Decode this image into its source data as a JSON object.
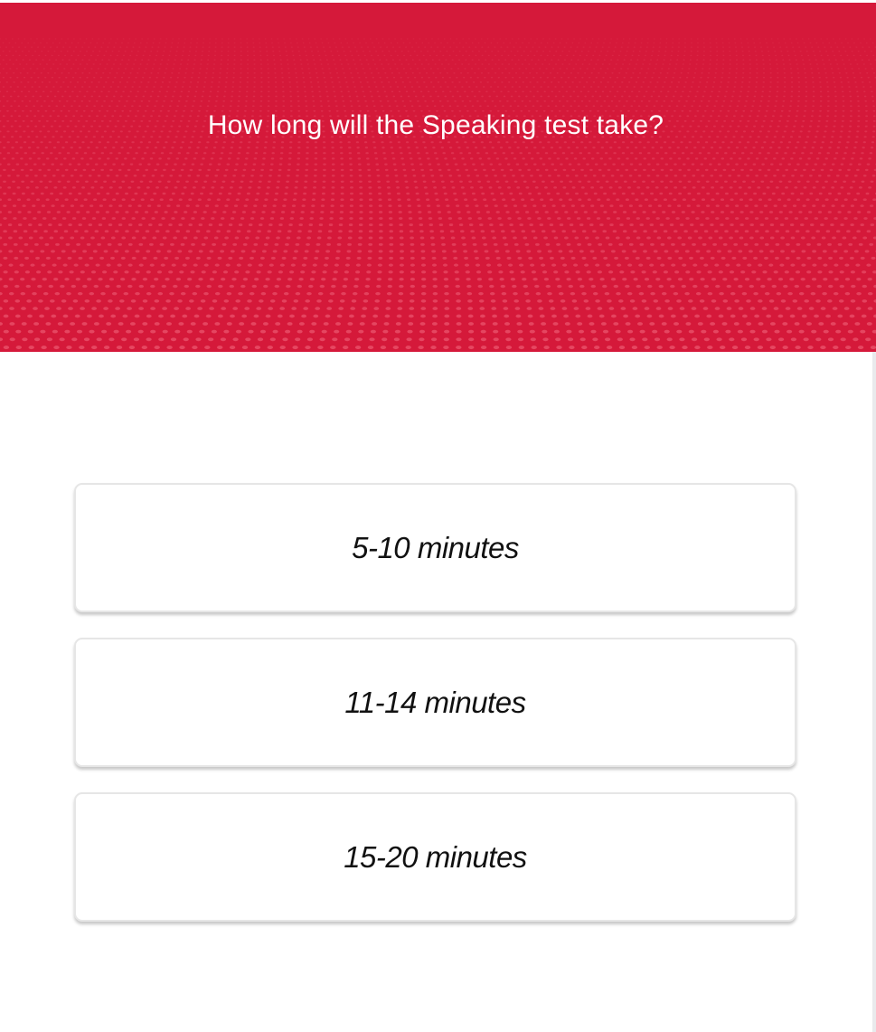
{
  "header": {
    "question": "How long will the Speaking test take?",
    "background_color": "#d5193a",
    "dot_color": "#ee5f77"
  },
  "options": [
    {
      "label": "5-10 minutes"
    },
    {
      "label": "11-14 minutes"
    },
    {
      "label": "15-20 minutes"
    }
  ]
}
